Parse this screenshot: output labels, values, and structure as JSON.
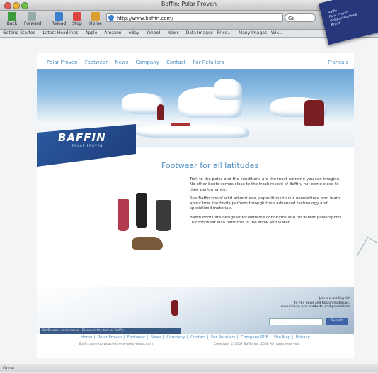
{
  "browser": {
    "title": "Baffin: Polar Proven",
    "toolbar": [
      {
        "label": "Back",
        "color": "#3c9c3c"
      },
      {
        "label": "Forward",
        "color": "#9aa"
      },
      {
        "label": "Reload",
        "color": "#3b7fd0"
      },
      {
        "label": "Stop",
        "color": "#d44"
      },
      {
        "label": "Home",
        "color": "#d9a030"
      }
    ],
    "url": "http://www.baffin.com/",
    "search_placeholder": "Go",
    "bookmarks": [
      "Getting Started",
      "Latest Headlines",
      "Apple",
      "Amazon",
      "eBay",
      "Yahoo!",
      "News",
      "Data Images - Price...",
      "Many Images - Wik..."
    ],
    "status": "Done"
  },
  "overlay_tag": [
    "Baffin",
    "Polar Proven",
    "Outdoor Footwear",
    "Brand"
  ],
  "site": {
    "nav": [
      "Polar Proven",
      "Footwear",
      "News",
      "Company",
      "Contact",
      "For Retailers"
    ],
    "nav_right": "Francais",
    "logo": "BAFFIN",
    "logo_sub": "POLAR PROVEN",
    "headline": "Footwear for all latitudes",
    "paragraphs": [
      "Trek to the poles and the conditions are the most extreme you can imagine. No other boots comes close to the track record of Baffin, nor come close to their performance.",
      "See Baffin boots' wild adventures, expeditions to our newsletters, and learn about how the boots perform through their advanced technology and specialized materials.",
      "Baffin boots are designed for extreme conditions and for winter powersports. Our footwear also performs in the snow and water."
    ],
    "caption": "Baffin user adventures - Discover the turn of Baffin",
    "signup_lines": [
      "Join our mailing list",
      "to find news and tips on materials,",
      "expeditions, new products, and promotions"
    ],
    "signup_button": "Submit",
    "footer_nav": [
      "Home",
      "Polar Proven",
      "Footwear",
      "News",
      "Company",
      "Contact",
      "For Retailers",
      "Company PDF",
      "Site Map",
      "Privacy"
    ],
    "copy_left": "Baffin.com/footwear/extreme-polar-boots.com",
    "copy_right": "Copyright © 2007 Baffin Inc. 2008 All rights reserved"
  }
}
